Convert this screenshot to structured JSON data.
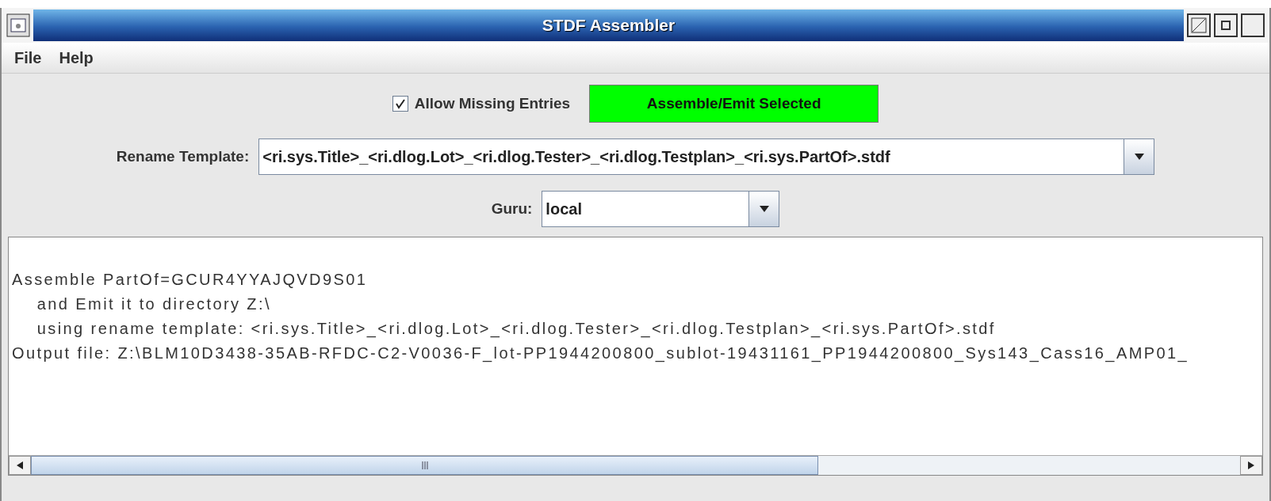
{
  "window": {
    "title": "STDF Assembler"
  },
  "menu": [
    "File",
    "Help"
  ],
  "allow_missing": {
    "label": "Allow Missing Entries",
    "checked": true
  },
  "assemble_button": "Assemble/Emit Selected",
  "rename_template": {
    "label": "Rename Template:",
    "value": "<ri.sys.Title>_<ri.dlog.Lot>_<ri.dlog.Tester>_<ri.dlog.Testplan>_<ri.sys.PartOf>.stdf"
  },
  "guru": {
    "label": "Guru:",
    "value": "local"
  },
  "log_lines": [
    "Assemble PartOf=GCUR4YYAJQVD9S01",
    "    and Emit it to directory Z:\\",
    "    using rename template: <ri.sys.Title>_<ri.dlog.Lot>_<ri.dlog.Tester>_<ri.dlog.Testplan>_<ri.sys.PartOf>.stdf",
    "Output file: Z:\\BLM10D3438-35AB-RFDC-C2-V0036-F_lot-PP1944200800_sublot-19431161_PP1944200800_Sys143_Cass16_AMP01_"
  ]
}
